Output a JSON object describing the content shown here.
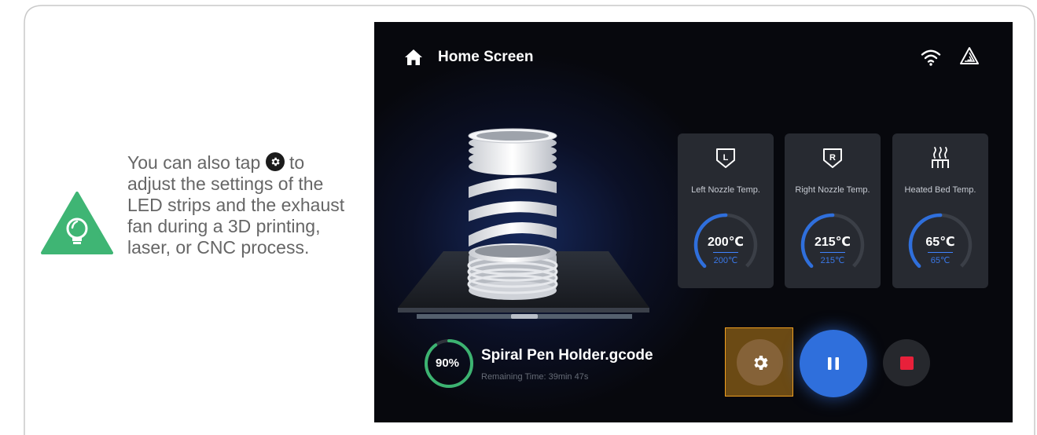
{
  "tip": {
    "line1": "You can also tap ",
    "rest": "to adjust the settings of the LED strips and the exhaust fan during a 3D printing, laser, or CNC process.",
    "icon": "lightbulb-icon"
  },
  "screen": {
    "title": "Home Screen",
    "icons": [
      "home-icon",
      "wifi-icon",
      "logo-icon"
    ],
    "cards": [
      {
        "label": "Left Nozzle Temp.",
        "value": "200℃",
        "target": "200℃",
        "icon": "left-nozzle-icon",
        "progress": 0.5
      },
      {
        "label": "Right Nozzle Temp.",
        "value": "215℃",
        "target": "215℃",
        "icon": "right-nozzle-icon",
        "progress": 0.5
      },
      {
        "label": "Heated Bed Temp.",
        "value": "65℃",
        "target": "65℃",
        "icon": "heated-bed-icon",
        "progress": 0.5
      }
    ],
    "job": {
      "progress": "90%",
      "progress_fraction": 0.9,
      "file": "Spiral Pen Holder.gcode",
      "remaining": "Remaining Time: 39min 47s"
    },
    "controls": [
      "settings-button",
      "pause-button",
      "stop-button"
    ],
    "colors": {
      "accent": "#2f6fdc",
      "highlight": "#f0a020",
      "stop": "#e8203a",
      "progress": "#3cb371"
    }
  }
}
